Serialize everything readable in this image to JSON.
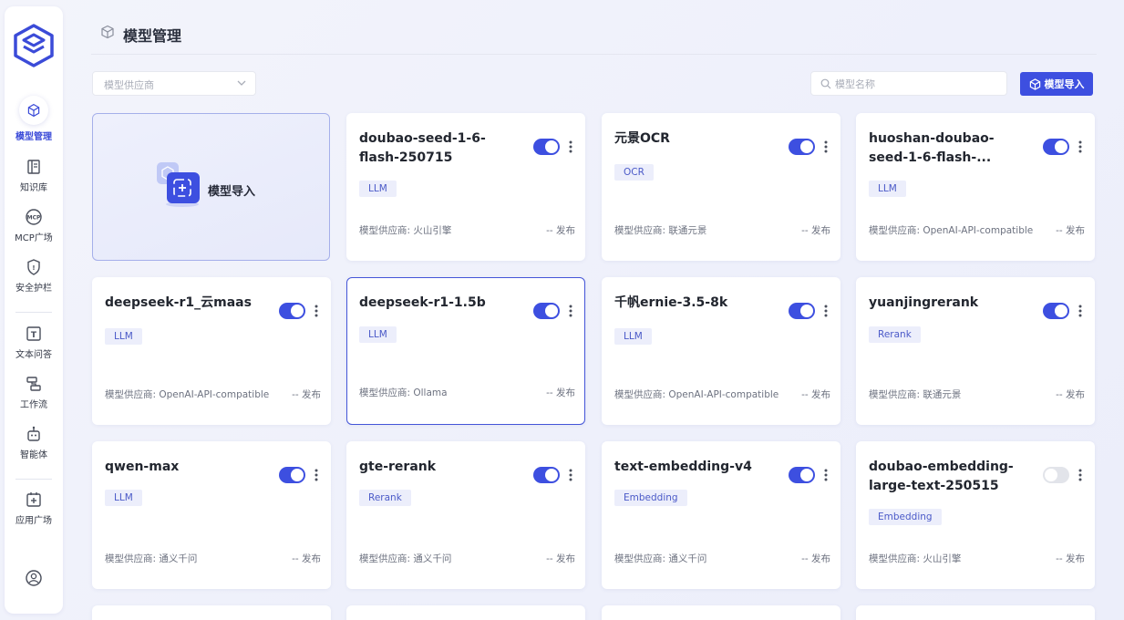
{
  "sidebar": {
    "items": [
      {
        "label": "模型管理",
        "icon": "cube-icon",
        "active": true
      },
      {
        "label": "知识库",
        "icon": "book-icon"
      },
      {
        "label": "MCP广场",
        "icon": "mcp-icon"
      },
      {
        "label": "安全护栏",
        "icon": "shield-icon"
      },
      {
        "label": "文本问答",
        "icon": "text-icon"
      },
      {
        "label": "工作流",
        "icon": "workflow-icon"
      },
      {
        "label": "智能体",
        "icon": "robot-icon"
      },
      {
        "label": "应用广场",
        "icon": "app-plus-icon"
      }
    ],
    "profile_icon": "user-circle-icon"
  },
  "header": {
    "title": "模型管理"
  },
  "toolbar": {
    "provider_placeholder": "模型供应商",
    "search_placeholder": "模型名称",
    "import_label": "模型导入"
  },
  "import_card": {
    "label": "模型导入"
  },
  "models": [
    {
      "name": "doubao-seed-1-6-flash-250715",
      "tag": "LLM",
      "provider": "模型供应商: 火山引擎",
      "status": "-- 发布",
      "enabled": true
    },
    {
      "name": "元景OCR",
      "tag": "OCR",
      "provider": "模型供应商: 联通元景",
      "status": "-- 发布",
      "enabled": true
    },
    {
      "name": "huoshan-doubao-seed-1-6-flash-...",
      "tag": "LLM",
      "provider": "模型供应商: OpenAI-API-compatible",
      "status": "-- 发布",
      "enabled": true
    },
    {
      "name": "deepseek-r1_云maas",
      "tag": "LLM",
      "provider": "模型供应商: OpenAI-API-compatible",
      "status": "-- 发布",
      "enabled": true
    },
    {
      "name": "deepseek-r1-1.5b",
      "tag": "LLM",
      "provider": "模型供应商: Ollama",
      "status": "-- 发布",
      "enabled": true,
      "selected": true
    },
    {
      "name": "千帆ernie-3.5-8k",
      "tag": "LLM",
      "provider": "模型供应商: OpenAI-API-compatible",
      "status": "-- 发布",
      "enabled": true
    },
    {
      "name": "yuanjingrerank",
      "tag": "Rerank",
      "provider": "模型供应商: 联通元景",
      "status": "-- 发布",
      "enabled": true
    },
    {
      "name": "qwen-max",
      "tag": "LLM",
      "provider": "模型供应商: 通义千问",
      "status": "-- 发布",
      "enabled": true
    },
    {
      "name": "gte-rerank",
      "tag": "Rerank",
      "provider": "模型供应商: 通义千问",
      "status": "-- 发布",
      "enabled": true
    },
    {
      "name": "text-embedding-v4",
      "tag": "Embedding",
      "provider": "模型供应商: 通义千问",
      "status": "-- 发布",
      "enabled": true
    },
    {
      "name": "doubao-embedding-large-text-250515",
      "tag": "Embedding",
      "provider": "模型供应商: 火山引擎",
      "status": "-- 发布",
      "enabled": false
    }
  ]
}
